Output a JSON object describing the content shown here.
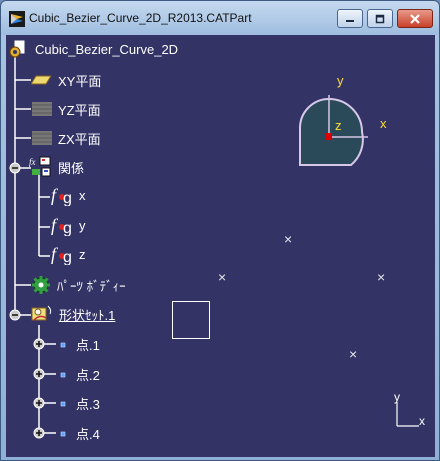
{
  "window": {
    "title": "Cubic_Bezier_Curve_2D_R2013.CATPart",
    "buttons": [
      "minimize",
      "maximize",
      "close"
    ]
  },
  "tree": {
    "root_label": "Cubic_Bezier_Curve_2D",
    "planes": [
      {
        "label": "XY平面",
        "icon": "xy-plane-icon"
      },
      {
        "label": "YZ平面",
        "icon": "yz-plane-icon"
      },
      {
        "label": "ZX平面",
        "icon": "zx-plane-icon"
      }
    ],
    "relations": {
      "label": "関係",
      "params": [
        {
          "symbol": "f",
          "label": "x"
        },
        {
          "symbol": "f",
          "label": "y"
        },
        {
          "symbol": "f",
          "label": "z"
        }
      ]
    },
    "part_body": {
      "label": "ﾊﾟｰﾂ ﾎﾞﾃﾞｨｰ"
    },
    "geo_set": {
      "label": "形状ｾｯﾄ.1",
      "points": [
        {
          "label": "点.1"
        },
        {
          "label": "点.2"
        },
        {
          "label": "点.3"
        },
        {
          "label": "点.4"
        }
      ]
    }
  },
  "compass": {
    "x_label": "x",
    "y_label": "y",
    "z_label": "z"
  },
  "mini_axes": {
    "x_label": "x",
    "y_label": "y"
  },
  "colors": {
    "background": "#333366",
    "tree_line": "#ffffff",
    "axis_label": "#ffdd33",
    "compass_fill": "#2a4a5a",
    "compass_edge": "#d8c8e8",
    "origin_dot": "#dd0000"
  }
}
